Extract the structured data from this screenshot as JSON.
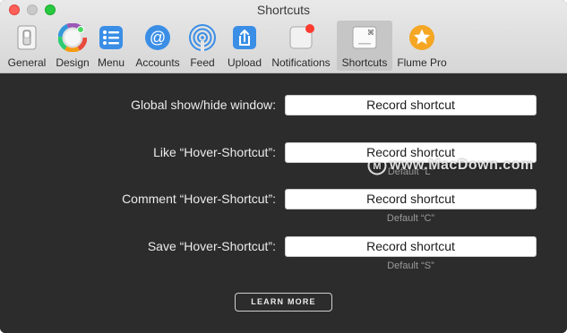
{
  "window": {
    "title": "Shortcuts"
  },
  "toolbar": {
    "items": [
      {
        "label": "General",
        "icon": "switch-icon"
      },
      {
        "label": "Design",
        "icon": "color-wheel-icon"
      },
      {
        "label": "Menu",
        "icon": "menu-list-icon"
      },
      {
        "label": "Accounts",
        "icon": "at-sign-icon"
      },
      {
        "label": "Feed",
        "icon": "broadcast-icon"
      },
      {
        "label": "Upload",
        "icon": "share-upload-icon"
      },
      {
        "label": "Notifications",
        "icon": "notification-badge-icon"
      },
      {
        "label": "Shortcuts",
        "icon": "keyboard-key-icon",
        "selected": true
      },
      {
        "label": "Flume Pro",
        "icon": "star-badge-icon"
      }
    ]
  },
  "shortcuts": {
    "global": {
      "label": "Global show/hide window:",
      "button": "Record shortcut"
    },
    "like": {
      "label": "Like “Hover-Shortcut”:",
      "button": "Record shortcut",
      "default": "Default “L”"
    },
    "comment": {
      "label": "Comment “Hover-Shortcut”:",
      "button": "Record shortcut",
      "default": "Default “C”"
    },
    "save": {
      "label": "Save “Hover-Shortcut”:",
      "button": "Record shortcut",
      "default": "Default “S”"
    }
  },
  "learn_more": "LEARN MORE",
  "watermark": "www.MacDown.com",
  "colors": {
    "accent_blue": "#3a8ee6",
    "content_bg": "#2c2c2c",
    "notification_red": "#ff3b30",
    "star_orange": "#f5a623"
  }
}
